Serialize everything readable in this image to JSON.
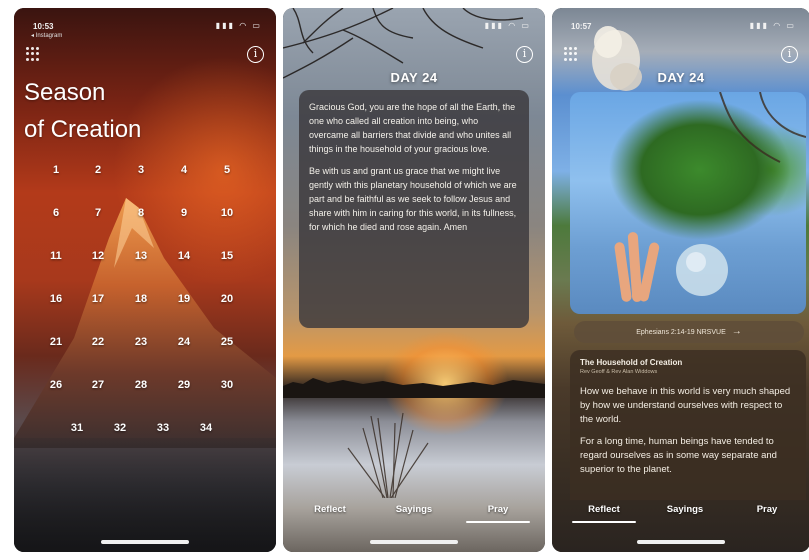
{
  "phone1": {
    "status_time": "10:53",
    "status_sub": "◂ Instagram",
    "title_line1": "Season",
    "title_line2": "of Creation",
    "days": [
      "1",
      "2",
      "3",
      "4",
      "5",
      "6",
      "7",
      "8",
      "9",
      "10",
      "11",
      "12",
      "13",
      "14",
      "15",
      "16",
      "17",
      "18",
      "19",
      "20",
      "21",
      "22",
      "23",
      "24",
      "25",
      "26",
      "27",
      "28",
      "29",
      "30",
      "31",
      "32",
      "33",
      "34"
    ]
  },
  "phone2": {
    "day_label": "DAY 24",
    "prayer_p1": "Gracious God, you are the hope of all the Earth, the one who called all creation into being, who overcame all barriers that divide and who unites all things in the household of your gracious love.",
    "prayer_p2": "Be with us and grant us grace that we might live gently with this planetary household of which we are part and be faithful as we seek to follow Jesus and share with him in caring for this world, in its fullness, for which he died and rose again. Amen",
    "tabs": [
      "Reflect",
      "Sayings",
      "Pray"
    ]
  },
  "phone3": {
    "status_time": "10:57",
    "day_label": "DAY 24",
    "reference": "Ephesians 2:14-19 NRSVUE",
    "card_title": "The Household of Creation",
    "card_subtitle": "Rev Geoff & Rev Alan Widdows",
    "body_p1": "How we behave in this world is very much shaped by how we understand ourselves with respect to the world.",
    "body_p2": "For a long time, human beings have tended to regard ourselves as in some way separate and superior to the planet.",
    "tabs": [
      "Reflect",
      "Sayings",
      "Pray"
    ]
  },
  "icons": {
    "status": "signal wifi battery",
    "grid": "grid-dots-icon",
    "info": "info-icon"
  }
}
